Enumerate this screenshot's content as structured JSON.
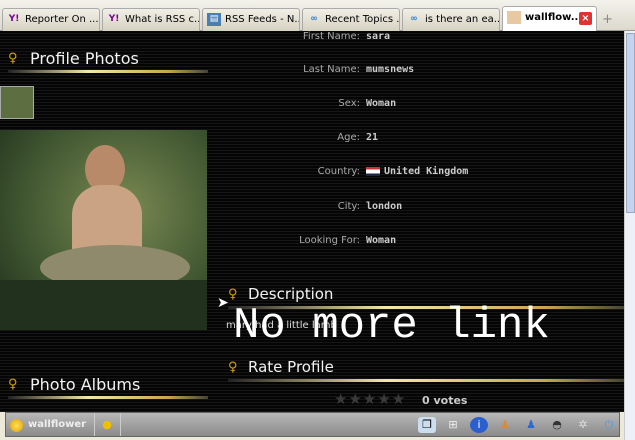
{
  "tabs": [
    {
      "label": "Reporter On ...",
      "icon": "yahoo-icon"
    },
    {
      "label": "What is RSS c...",
      "icon": "yahoo-icon"
    },
    {
      "label": "RSS Feeds - N...",
      "icon": "page-icon"
    },
    {
      "label": "Recent Topics ...",
      "icon": "forum-icon"
    },
    {
      "label": "is there an ea...",
      "icon": "forum-icon"
    },
    {
      "label": "wallflow...",
      "icon": "profile-icon",
      "active": true
    }
  ],
  "sections": {
    "profile_photos": "Profile Photos",
    "photo_albums": "Photo Albums",
    "description": "Description",
    "rate_profile": "Rate Profile"
  },
  "fields": [
    {
      "label": "First Name:",
      "value": "sara"
    },
    {
      "label": "Last Name:",
      "value": "mumsnews"
    },
    {
      "label": "Sex:",
      "value": "Woman"
    },
    {
      "label": "Age:",
      "value": "21"
    },
    {
      "label": "Country:",
      "value": "United Kingdom"
    },
    {
      "label": "City:",
      "value": "london"
    },
    {
      "label": "Looking For:",
      "value": "Woman"
    }
  ],
  "description_text": "mary had a little lamb",
  "overlay_text": "No more link",
  "rating": {
    "stars": 0,
    "max": 5,
    "votes_label": "0 votes"
  },
  "bottom_bar": {
    "username": "wallflower"
  }
}
